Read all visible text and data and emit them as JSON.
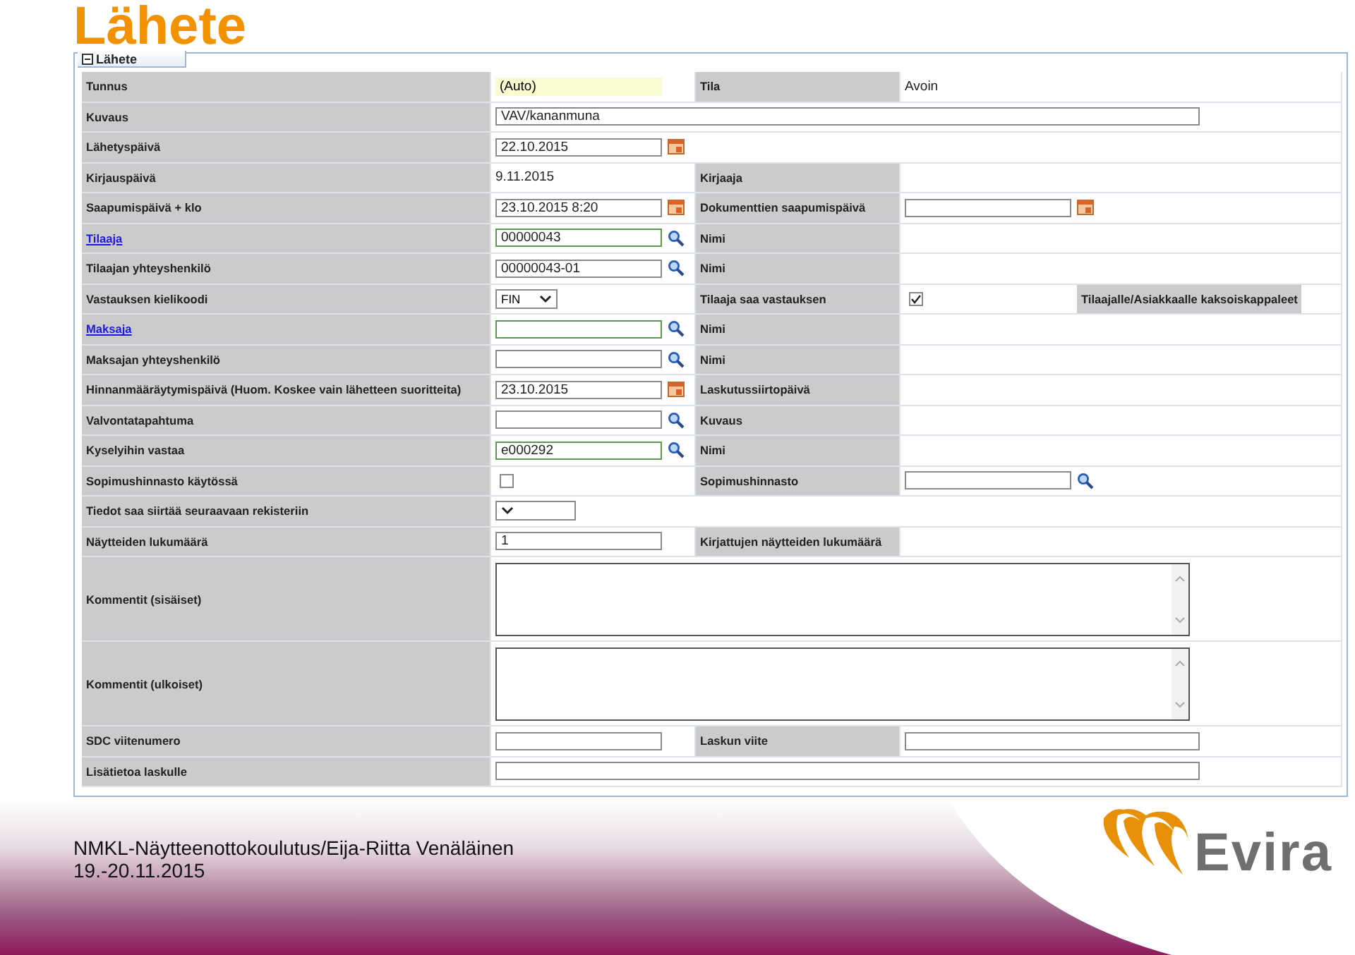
{
  "title": "Lähete",
  "tab": {
    "label": "Lähete",
    "expanded": true
  },
  "rows": [
    {
      "label": "Tunnus",
      "link": false,
      "field": {
        "kind": "auto",
        "value": "(Auto)"
      },
      "right_label": "Tila",
      "right_field": {
        "kind": "text",
        "value": "Avoin"
      }
    },
    {
      "label": "Kuvaus",
      "link": false,
      "field": {
        "kind": "input",
        "value": "VAV/kananmuna",
        "wide": true
      }
    },
    {
      "label": "Lähetyspäivä",
      "link": false,
      "field": {
        "kind": "date",
        "value": "22.10.2015"
      }
    },
    {
      "label": "Kirjauspäivä",
      "link": false,
      "field": {
        "kind": "text",
        "value": "9.11.2015"
      },
      "right_label": "Kirjaaja"
    },
    {
      "label": "Saapumispäivä + klo",
      "link": false,
      "field": {
        "kind": "date",
        "value": "23.10.2015 8:20"
      },
      "right_label": "Dokumenttien saapumispäivä",
      "right_field": {
        "kind": "date"
      }
    },
    {
      "label": "Tilaaja",
      "link": true,
      "field": {
        "kind": "lookup",
        "value": "00000043",
        "required": true
      },
      "right_label": "Nimi"
    },
    {
      "label": "Tilaajan yhteyshenkilö",
      "link": false,
      "field": {
        "kind": "lookup",
        "value": "00000043-01",
        "required": false
      },
      "right_label": "Nimi"
    },
    {
      "label": "Vastauksen kielikoodi",
      "link": false,
      "field": {
        "kind": "select",
        "value": "FIN"
      },
      "right_label": "Tilaaja saa vastauksen",
      "right_field": {
        "kind": "checkbox",
        "checked": true,
        "extra_label": "Tilaajalle/Asiakkaalle kaksoiskappaleet"
      }
    },
    {
      "label": "Maksaja",
      "link": true,
      "field": {
        "kind": "lookup",
        "required": true
      },
      "right_label": "Nimi"
    },
    {
      "label": "Maksajan yhteyshenkilö",
      "link": false,
      "field": {
        "kind": "lookup",
        "required": false
      },
      "right_label": "Nimi"
    },
    {
      "label": "Hinnanmääräytymispäivä (Huom. Koskee vain lähetteen suoritteita)",
      "link": false,
      "field": {
        "kind": "date",
        "value": "23.10.2015"
      },
      "right_label": "Laskutussiirtopäivä"
    },
    {
      "label": "Valvontatapahtuma",
      "link": false,
      "field": {
        "kind": "lookup",
        "required": false
      },
      "right_label": "Kuvaus"
    },
    {
      "label": "Kyselyihin vastaa",
      "link": false,
      "field": {
        "kind": "lookup",
        "value": "e000292",
        "required": true
      },
      "right_label": "Nimi"
    },
    {
      "label": "Sopimushinnasto käytössä",
      "link": false,
      "field": {
        "kind": "checkbox",
        "checked": false
      },
      "right_label": "Sopimushinnasto",
      "right_field": {
        "kind": "lookup",
        "required": false
      }
    },
    {
      "label": "Tiedot saa siirtää seuraavaan rekisteriin",
      "link": false,
      "field": {
        "kind": "select"
      }
    },
    {
      "label": "Näytteiden lukumäärä",
      "link": false,
      "field": {
        "kind": "input",
        "value": "1",
        "wide": false
      },
      "right_label": "Kirjattujen näytteiden lukumäärä"
    },
    {
      "label": "Kommentit (sisäiset)",
      "link": false,
      "field": {
        "kind": "textarea"
      }
    },
    {
      "label": "Kommentit (ulkoiset)",
      "link": false,
      "field": {
        "kind": "textarea"
      }
    },
    {
      "label": "SDC viitenumero",
      "link": false,
      "field": {
        "kind": "input",
        "wide": false
      },
      "right_label": "Laskun viite",
      "right_field": {
        "kind": "input",
        "wide": true
      }
    },
    {
      "label": "Lisätietoa laskulle",
      "link": false,
      "field": {
        "kind": "input",
        "wide": true
      }
    }
  ],
  "footer": {
    "lines": [
      "NMKL-Näytteenottokoulutus/Eija-Riitta Venäläinen",
      "19.-20.11.2015"
    ],
    "logo_text": "Evira"
  }
}
